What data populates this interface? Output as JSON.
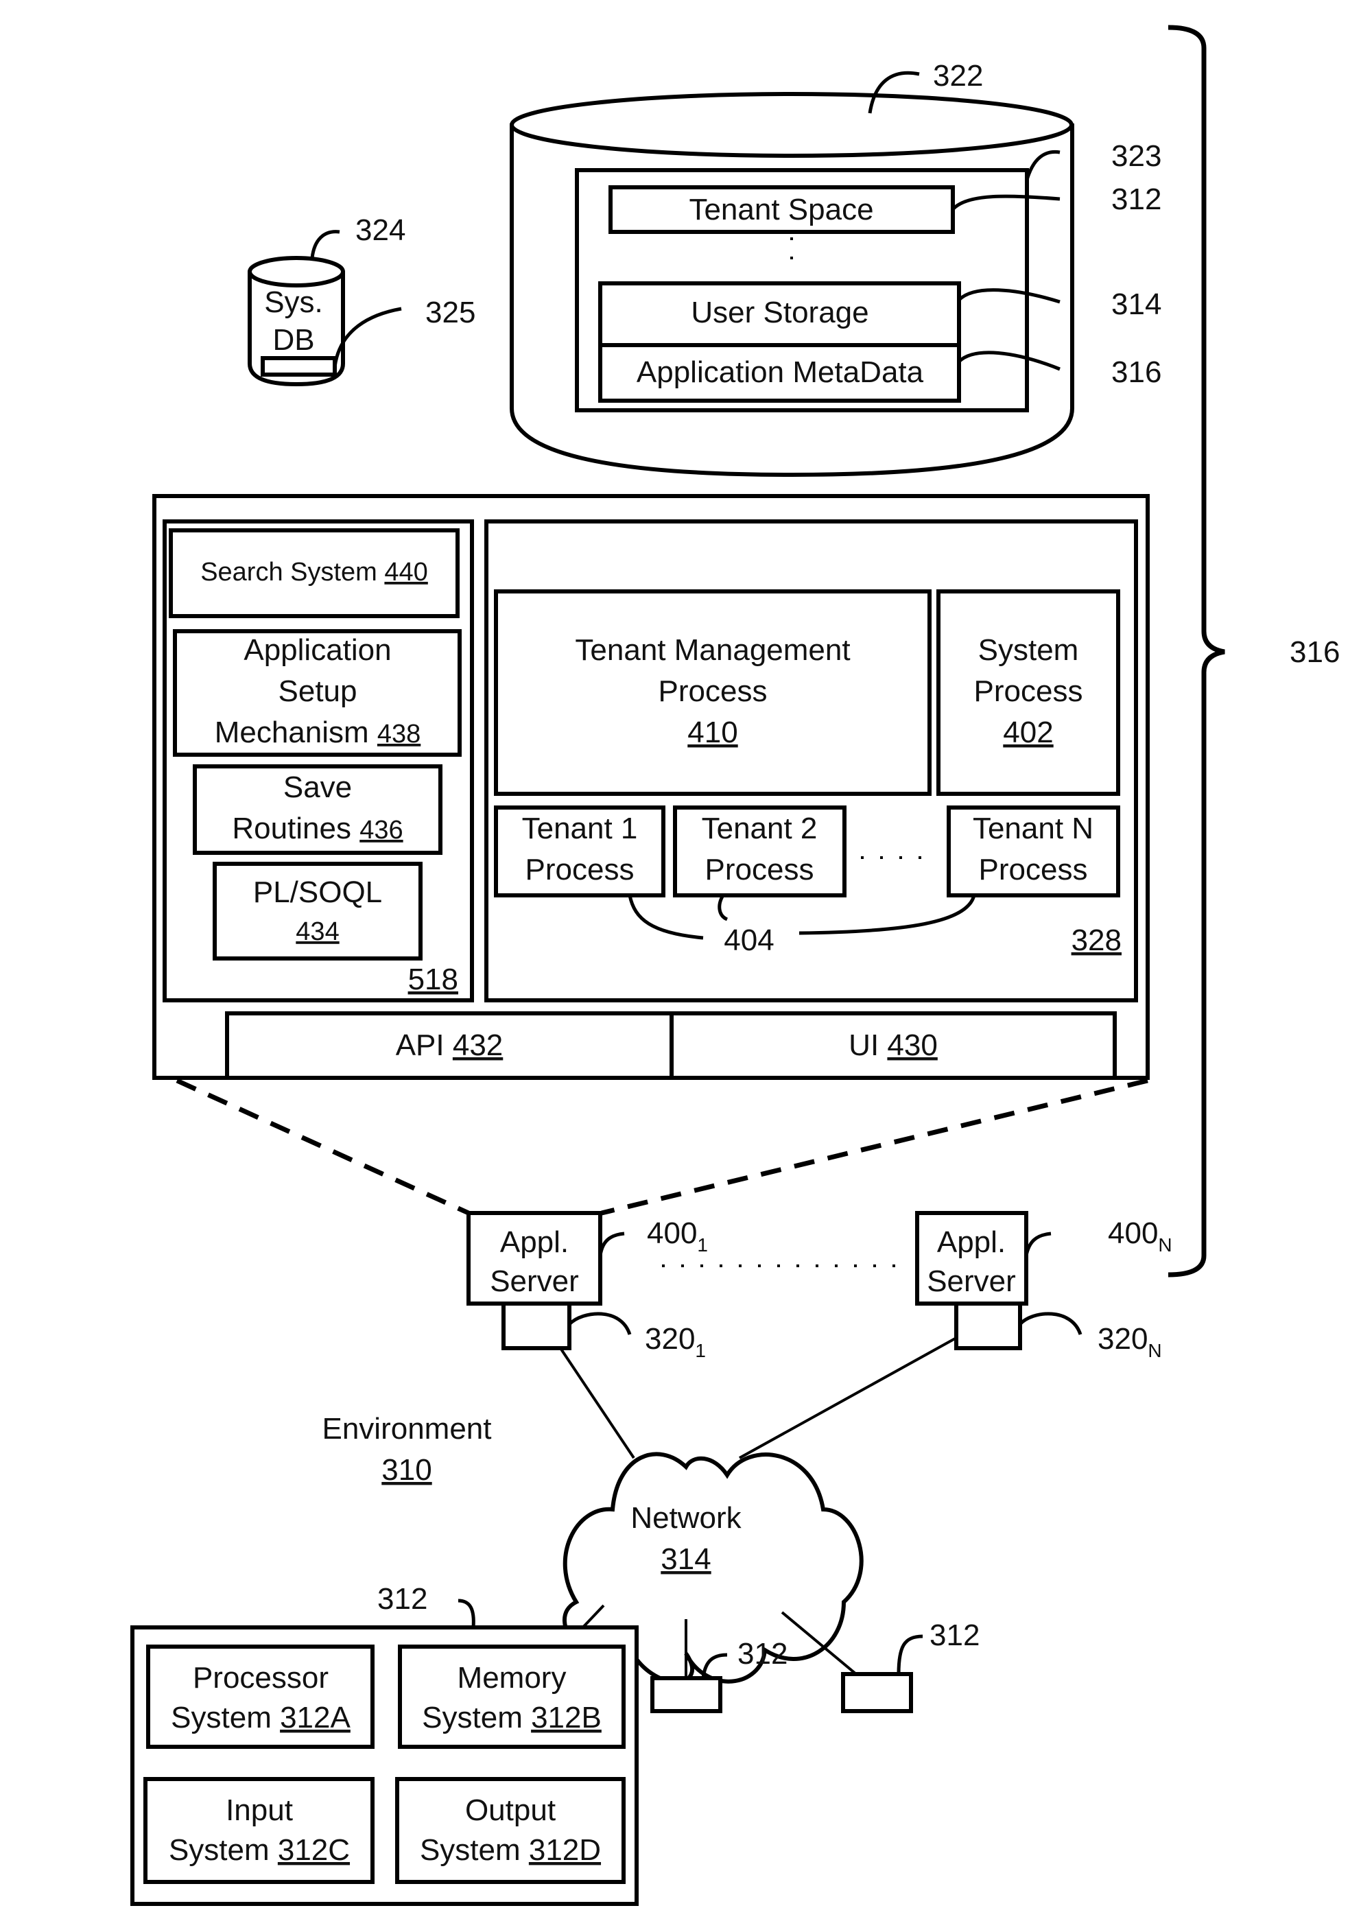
{
  "database": {
    "label": "322",
    "container_label": "323",
    "tenant_space": {
      "text": "Tenant Space",
      "ref": "312"
    },
    "user_storage": {
      "text": "User Storage",
      "ref": "314"
    },
    "app_metadata": {
      "text": "Application MetaData",
      "ref": "316"
    }
  },
  "sys_db": {
    "line1": "Sys.",
    "line2": "DB",
    "ref": "324",
    "item_ref": "325"
  },
  "brace_label": "316",
  "server_detail": {
    "left_panel_ref": "518",
    "search_system": {
      "text": "Search System ",
      "ref": "440"
    },
    "app_setup": {
      "line1": "Application",
      "line2": "Setup",
      "line3": "Mechanism ",
      "ref": "438"
    },
    "save_routines": {
      "line1": "Save",
      "line2": "Routines ",
      "ref": "436"
    },
    "plsoql": {
      "line1": "PL/SOQL",
      "ref": "434"
    },
    "right_panel_ref": "328",
    "tenant_mgmt": {
      "line1": "Tenant Management",
      "line2": "Process",
      "ref": "410"
    },
    "system_process": {
      "line1": "System",
      "line2": "Process",
      "ref": "402"
    },
    "tenant1": {
      "line1": "Tenant 1",
      "line2": "Process"
    },
    "tenant2": {
      "line1": "Tenant 2",
      "line2": "Process"
    },
    "tenantN": {
      "line1": "Tenant N",
      "line2": "Process"
    },
    "tenant_process_ref": "404",
    "api": {
      "text": "API ",
      "ref": "432"
    },
    "ui": {
      "text": "UI ",
      "ref": "430"
    }
  },
  "servers": [
    {
      "line1": "Appl.",
      "line2": "Server",
      "ref": "400",
      "ref_sub": "1",
      "port_ref": "320",
      "port_sub": "1"
    },
    {
      "line1": "Appl.",
      "line2": "Server",
      "ref": "400",
      "ref_sub": "N",
      "port_ref": "320",
      "port_sub": "N"
    }
  ],
  "environment": {
    "text": "Environment",
    "ref": "310"
  },
  "network": {
    "text": "Network",
    "ref": "314"
  },
  "user_system": {
    "ref": "312",
    "processor": {
      "line1": "Processor",
      "line2": "System ",
      "ref": "312A"
    },
    "memory": {
      "line1": "Memory",
      "line2": "System ",
      "ref": "312B"
    },
    "input": {
      "line1": "Input",
      "line2": "System ",
      "ref": "312C"
    },
    "output": {
      "line1": "Output",
      "line2": "System ",
      "ref": "312D"
    }
  },
  "other_clients": [
    {
      "ref": "312"
    },
    {
      "ref": "312"
    }
  ]
}
